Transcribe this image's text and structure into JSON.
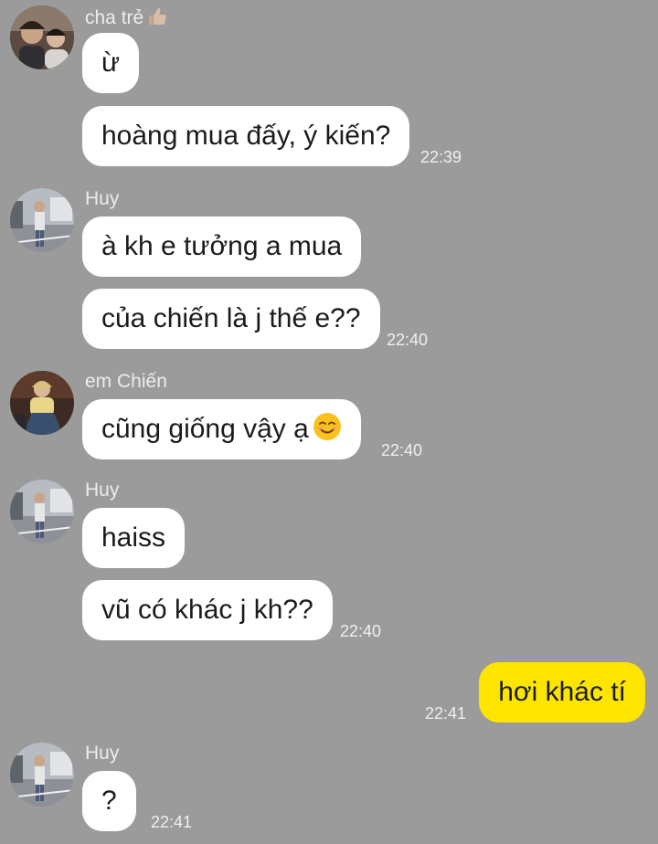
{
  "chat": {
    "groups": [
      {
        "sender": "cha trẻ",
        "messages": [
          "ừ",
          "hoàng mua đấy, ý kiến?"
        ],
        "time": "22:39"
      },
      {
        "sender": "Huy",
        "messages": [
          "à kh e tưởng a mua",
          "của chiến là j thế e??"
        ],
        "time": "22:40"
      },
      {
        "sender": "em Chiến",
        "messages": [
          "cũng giống vậy ạ"
        ],
        "time": "22:40"
      },
      {
        "sender": "Huy",
        "messages": [
          "haiss",
          "vũ có khác j kh??"
        ],
        "time": "22:40"
      },
      {
        "sender": "me",
        "messages": [
          "hơi khác tí"
        ],
        "time": "22:41"
      },
      {
        "sender": "Huy",
        "messages": [
          "?"
        ],
        "time": "22:41"
      }
    ]
  },
  "icons": {
    "sender_badge": "thumbs-up-emoji",
    "message_emoji": "smiling-face-emoji"
  },
  "colors": {
    "background": "#9b9b9b",
    "incoming_bubble": "#ffffff",
    "outgoing_bubble": "#fee500",
    "timestamp": "#efefef",
    "sender_name": "#ececec"
  }
}
